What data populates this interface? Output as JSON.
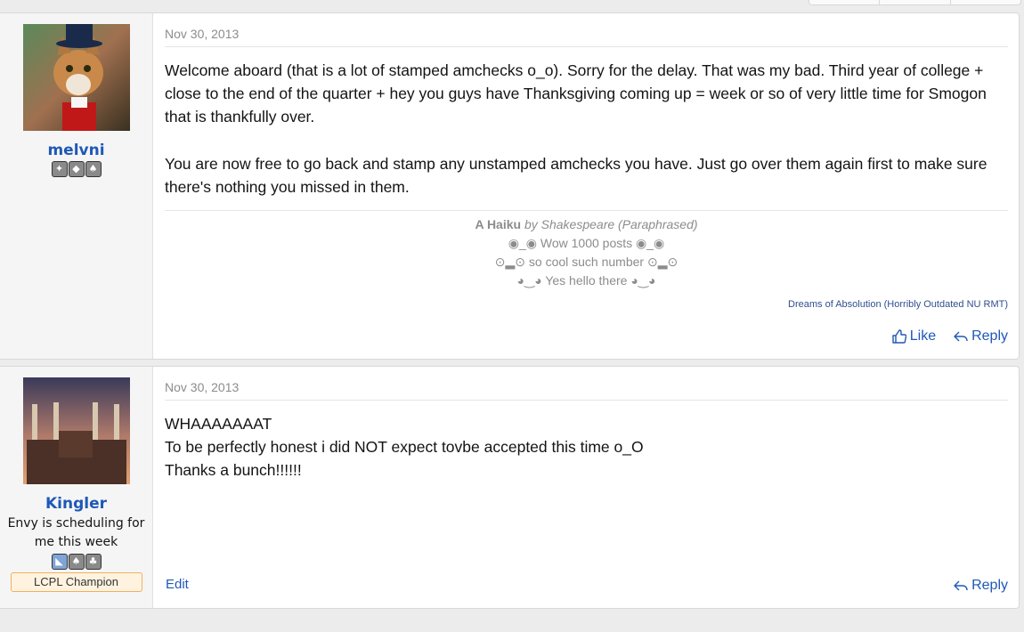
{
  "posts": [
    {
      "username": "melvni",
      "date": "Nov 30, 2013",
      "body": [
        "Welcome aboard (that is a lot of stamped amchecks o_o). Sorry for the delay. That was my bad. Third year of college + close to the end of the quarter + hey you guys have Thanksgiving coming up = week or so of very little time for Smogon that is thankfully over.",
        "You are now free to go back and stamp any unstamped amchecks you have. Just go over them again first to make sure there's nothing you missed in them."
      ],
      "signature": {
        "title": "A Haiku",
        "byline": "by Shakespeare (Paraphrased)",
        "lines": [
          "◉_◉ Wow 1000 posts ◉_◉",
          "⊙▂⊙ so cool such number ⊙▂⊙",
          "◕‿◕ Yes hello there ◕‿◕"
        ],
        "link": "Dreams of Absolution (Horribly Outdated NU RMT)"
      },
      "actions": {
        "like": "Like",
        "reply": "Reply"
      },
      "badges": [
        "badge-1",
        "badge-2",
        "badge-3"
      ]
    },
    {
      "username": "Kingler",
      "user_title": "Envy is scheduling for me this week",
      "banner": "LCPL Champion",
      "date": "Nov 30, 2013",
      "body": [
        "WHAAAAAAAT",
        "To be perfectly honest i did NOT expect tovbe accepted this time o_O",
        "Thanks a bunch!!!!!!"
      ],
      "actions": {
        "edit": "Edit",
        "reply": "Reply"
      },
      "badges": [
        "badge-1",
        "badge-2",
        "badge-3"
      ]
    }
  ],
  "colors": {
    "link": "#1f58b7",
    "muted": "#8c8c8c",
    "banner_bg": "#fff3e0"
  }
}
